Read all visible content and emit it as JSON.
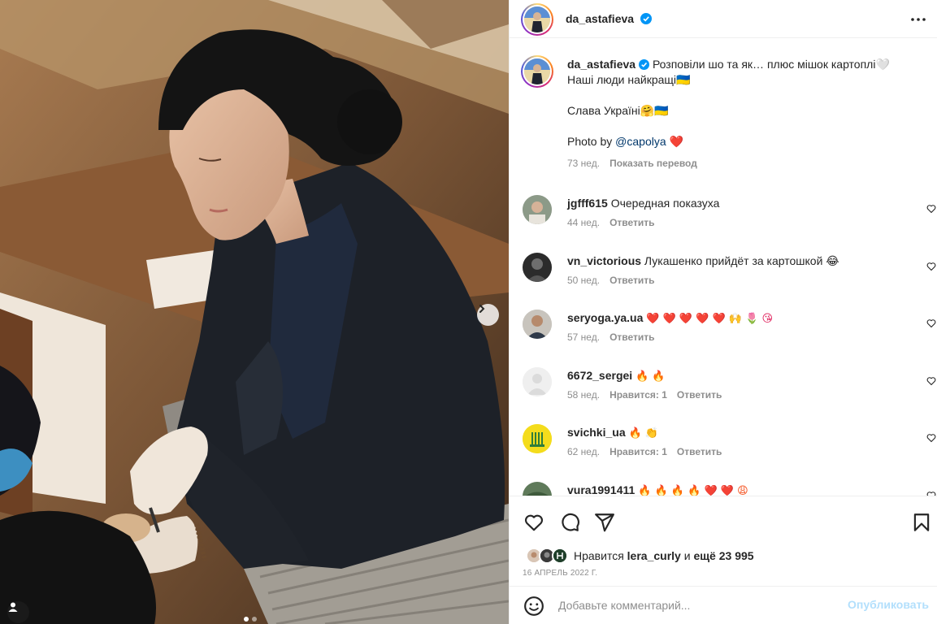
{
  "post": {
    "username": "da_astafieva",
    "verified": true
  },
  "caption": {
    "username": "da_astafieva",
    "line1": "Розповіли шо та як… плюс мішок картоплі🤍",
    "line2": "Наші люди найкращі🇺🇦",
    "line3": "Слава Україні🤗🇺🇦",
    "line4_prefix": "Photo by ",
    "line4_mention": "@capolya",
    "line4_suffix": " ❤️",
    "time": "73 нед.",
    "translate": "Показать перевод"
  },
  "comments": [
    {
      "username": "jgfff615",
      "text": "Очередная показуха",
      "time": "44 нед.",
      "likes": "",
      "reply": "Ответить"
    },
    {
      "username": "vn_victorious",
      "text": "Лукашенко прийдёт за картошкой 😂",
      "time": "50 нед.",
      "likes": "",
      "reply": "Ответить"
    },
    {
      "username": "seryoga.ya.ua",
      "text": "❤️ ❤️ ❤️ ❤️ ❤️ 🙌 🌷 😘",
      "time": "57 нед.",
      "likes": "",
      "reply": "Ответить"
    },
    {
      "username": "6672_sergei",
      "text": "🔥 🔥",
      "time": "58 нед.",
      "likes": "Нравится: 1",
      "reply": "Ответить"
    },
    {
      "username": "svichki_ua",
      "text": "🔥 👏",
      "time": "62 нед.",
      "likes": "Нравится: 1",
      "reply": "Ответить"
    },
    {
      "username": "vura1991411",
      "text": "🔥 🔥 🔥 🔥 ❤️ ❤️ 😩",
      "time": "",
      "likes": "",
      "reply": ""
    }
  ],
  "likes": {
    "prefix": "Нравится ",
    "user": "lera_curly",
    "middle": " и ",
    "others": "ещё 23 995"
  },
  "date": "16 АПРЕЛЬ 2022 Г.",
  "add_comment": {
    "placeholder": "Добавьте комментарий...",
    "post_label": "Опубликовать"
  },
  "icons": {
    "more": "more-horizontal-icon",
    "like": "heart-icon",
    "comment": "comment-icon",
    "share": "share-icon",
    "save": "bookmark-icon",
    "emoji": "emoji-icon",
    "next": "chevron-right-icon",
    "tags": "user-tag-icon"
  },
  "colors": {
    "verified": "#0095f6",
    "post_disabled": "#b2dffc",
    "meta": "#8e8e8e",
    "text": "#262626"
  },
  "carousel": {
    "slides": 2,
    "current": 1
  }
}
